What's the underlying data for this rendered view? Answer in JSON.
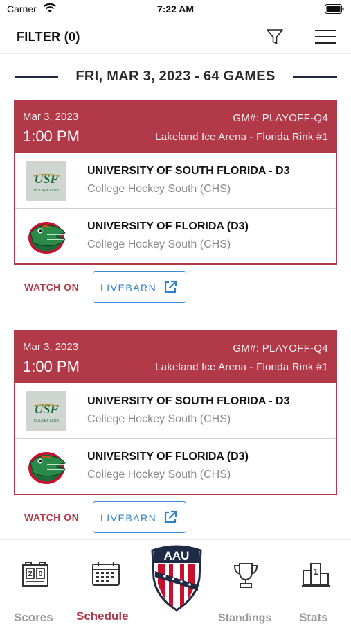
{
  "status_bar": {
    "carrier": "Carrier",
    "time": "7:22 AM"
  },
  "topbar": {
    "filter_label": "FILTER (0)"
  },
  "date_header": {
    "text": "FRI, MAR 3, 2023 - 64 GAMES"
  },
  "games": [
    {
      "date": "Mar 3, 2023",
      "time": "1:00 PM",
      "game_number": "GM#: PLAYOFF-Q4",
      "venue": "Lakeland Ice Arena - Florida Rink #1",
      "teams": [
        {
          "name": "UNIVERSITY OF SOUTH FLORIDA - D3",
          "league": "College Hockey South (CHS)",
          "logo": "usf-logo",
          "logo_text": "USF",
          "logo_subtext": "HOCKEY CLUB"
        },
        {
          "name": "UNIVERSITY OF FLORIDA (D3)",
          "league": "College Hockey South (CHS)",
          "logo": "gator-logo"
        }
      ],
      "watch_label": "WATCH ON",
      "livebarn_label": "LIVEBARN"
    },
    {
      "date": "Mar 3, 2023",
      "time": "1:00 PM",
      "game_number": "GM#: PLAYOFF-Q4",
      "venue": "Lakeland Ice Arena - Florida Rink #1",
      "teams": [
        {
          "name": "UNIVERSITY OF SOUTH FLORIDA - D3",
          "league": "College Hockey South (CHS)",
          "logo": "usf-logo",
          "logo_text": "USF",
          "logo_subtext": "HOCKEY CLUB"
        },
        {
          "name": "UNIVERSITY OF FLORIDA (D3)",
          "league": "College Hockey South (CHS)",
          "logo": "gator-logo"
        }
      ],
      "watch_label": "WATCH ON",
      "livebarn_label": "LIVEBARN"
    }
  ],
  "tabs": [
    {
      "label": "Scores",
      "icon": "scoreboard-icon",
      "active": false
    },
    {
      "label": "Schedule",
      "icon": "calendar-icon",
      "active": true
    },
    {
      "label": "",
      "icon": "aau-logo",
      "active": false,
      "logo_text": "AAU"
    },
    {
      "label": "Standings",
      "icon": "trophy-icon",
      "active": false
    },
    {
      "label": "Stats",
      "icon": "podium-icon",
      "active": false
    }
  ],
  "colors": {
    "accent": "#b23a48",
    "navy": "#1f2a44",
    "link_blue": "#2f80cc",
    "muted": "#8a8a8a"
  }
}
